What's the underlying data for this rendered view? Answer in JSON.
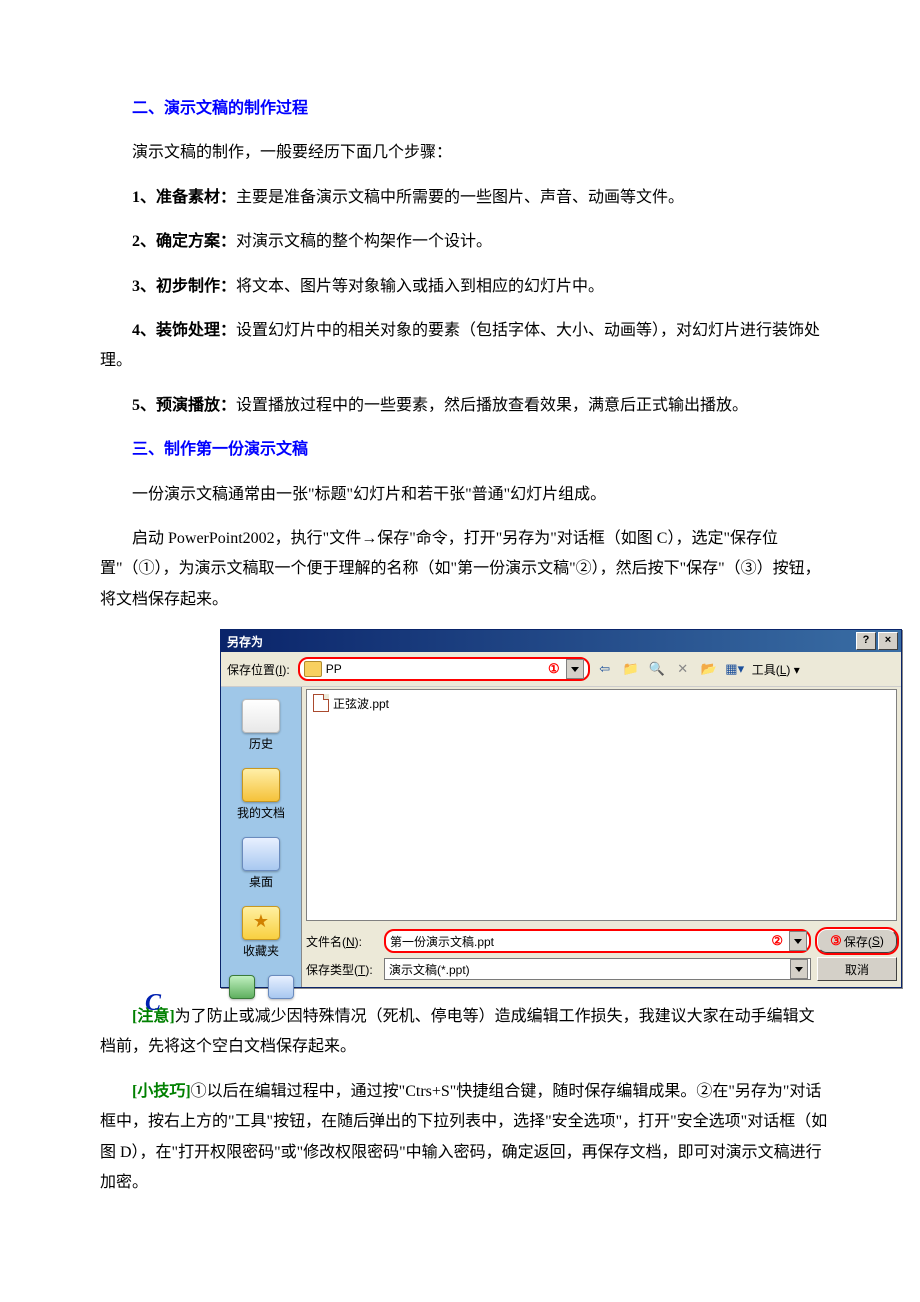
{
  "headings": {
    "h2": "二、演示文稿的制作过程",
    "h3": "三、制作第一份演示文稿"
  },
  "paras": {
    "p_intro2": "演示文稿的制作，一般要经历下面几个步骤：",
    "step1_b": "1、准备素材：",
    "step1_t": "主要是准备演示文稿中所需要的一些图片、声音、动画等文件。",
    "step2_b": "2、确定方案：",
    "step2_t": "对演示文稿的整个构架作一个设计。",
    "step3_b": "3、初步制作：",
    "step3_t": "将文本、图片等对象输入或插入到相应的幻灯片中。",
    "step4_b": "4、装饰处理：",
    "step4_t": "设置幻灯片中的相关对象的要素（包括字体、大小、动画等），对幻灯片进行装饰处理。",
    "step5_b": "5、预演播放：",
    "step5_t": "设置播放过程中的一些要素，然后播放查看效果，满意后正式输出播放。",
    "p_intro3": "一份演示文稿通常由一张\"标题\"幻灯片和若干张\"普通\"幻灯片组成。",
    "p_start3": "启动 PowerPoint2002，执行\"文件→保存\"命令，打开\"另存为\"对话框（如图 C），选定\"保存位置\"（①），为演示文稿取一个便于理解的名称（如\"第一份演示文稿\"②），然后按下\"保存\"（③）按钮，将文档保存起来。",
    "note_tag": "[注意]",
    "note_body": "为了防止或减少因特殊情况（死机、停电等）造成编辑工作损失，我建议大家在动手编辑文档前，先将这个空白文档保存起来。",
    "tip_tag": "[小技巧]",
    "tip_body": "①以后在编辑过程中，通过按\"Ctrs+S\"快捷组合键，随时保存编辑成果。②在\"另存为\"对话框中，按右上方的\"工具\"按钮，在随后弹出的下拉列表中，选择\"安全选项\"，打开\"安全选项\"对话框（如图 D），在\"打开权限密码\"或\"修改权限密码\"中输入密码，确定返回，再保存文档，即可对演示文稿进行加密。"
  },
  "dialog": {
    "title": "另存为",
    "help_btn": "?",
    "close_btn": "×",
    "save_loc_label_pre": "保存位置(",
    "save_loc_hotkey": "I",
    "save_loc_label_post": "):",
    "folder_name": "PP",
    "callout1": "①",
    "callout2": "②",
    "callout3": "③",
    "tools_label_pre": "工具(",
    "tools_hotkey": "L",
    "tools_label_post": ")",
    "places": {
      "history": "历史",
      "mydocs": "我的文档",
      "desktop": "桌面",
      "favorites": "收藏夹"
    },
    "file_in_list": "正弦波.ppt",
    "filename_label_pre": "文件名(",
    "filename_hotkey": "N",
    "filename_label_post": "):",
    "filename_value": "第一份演示文稿.ppt",
    "savetype_label_pre": "保存类型(",
    "savetype_hotkey": "T",
    "savetype_label_post": "):",
    "savetype_value": "演示文稿(*.ppt)",
    "save_btn_pre": "保存(",
    "save_hotkey": "S",
    "save_btn_post": ")",
    "cancel_btn": "取消",
    "fig_mark": "C"
  }
}
